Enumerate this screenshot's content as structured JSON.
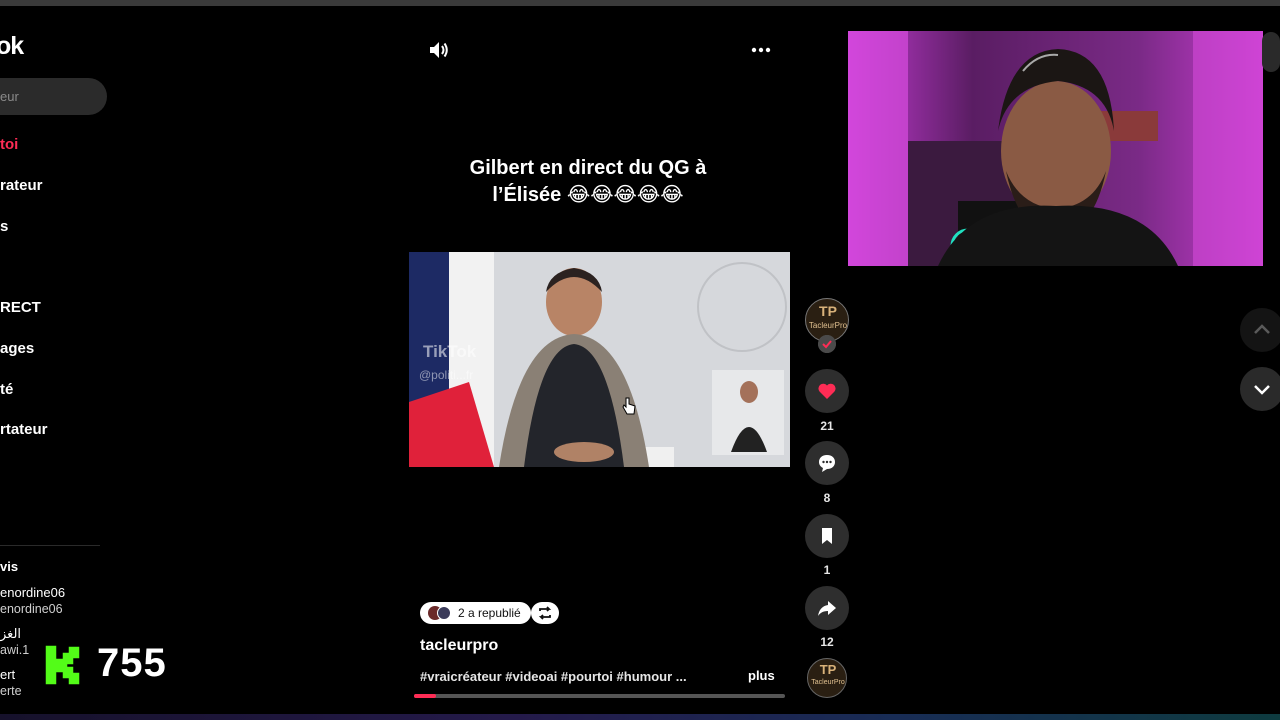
{
  "sidebar": {
    "logo": "ok",
    "search_placeholder": "eur",
    "nav": [
      {
        "label": "toi",
        "active": true
      },
      {
        "label": "rateur",
        "active": false
      },
      {
        "label": "s",
        "active": false
      },
      {
        "label": "RECT",
        "active": false
      },
      {
        "label": "ages",
        "active": false
      },
      {
        "label": "té",
        "active": false
      },
      {
        "label": "rtateur",
        "active": false
      }
    ],
    "friends_heading": "vis",
    "friends": [
      {
        "name": "enordine06",
        "handle": "enordine06"
      },
      {
        "name": "الغز",
        "handle": "awi.1"
      },
      {
        "name": "ert",
        "handle": "erte"
      }
    ]
  },
  "kick": {
    "count": "755",
    "color": "#53fc18"
  },
  "post": {
    "caption_line1": "Gilbert en direct du QG à",
    "caption_line2": "l’Élisée 😂😂😂😂😂",
    "video_watermark": "TikTok",
    "video_handle": "@politi...fr",
    "repost_label": "2 a republié",
    "author": "tacleurpro",
    "hashtags": "#vraicréateur #videoai #pourtoi #humour ...",
    "more_label": "plus",
    "progress": 0.06
  },
  "actions": {
    "avatar_label": "TacleurPro",
    "likes": "21",
    "comments": "8",
    "saves": "1",
    "shares": "12"
  },
  "colors": {
    "accent": "#fe2c55",
    "background": "#000000"
  }
}
